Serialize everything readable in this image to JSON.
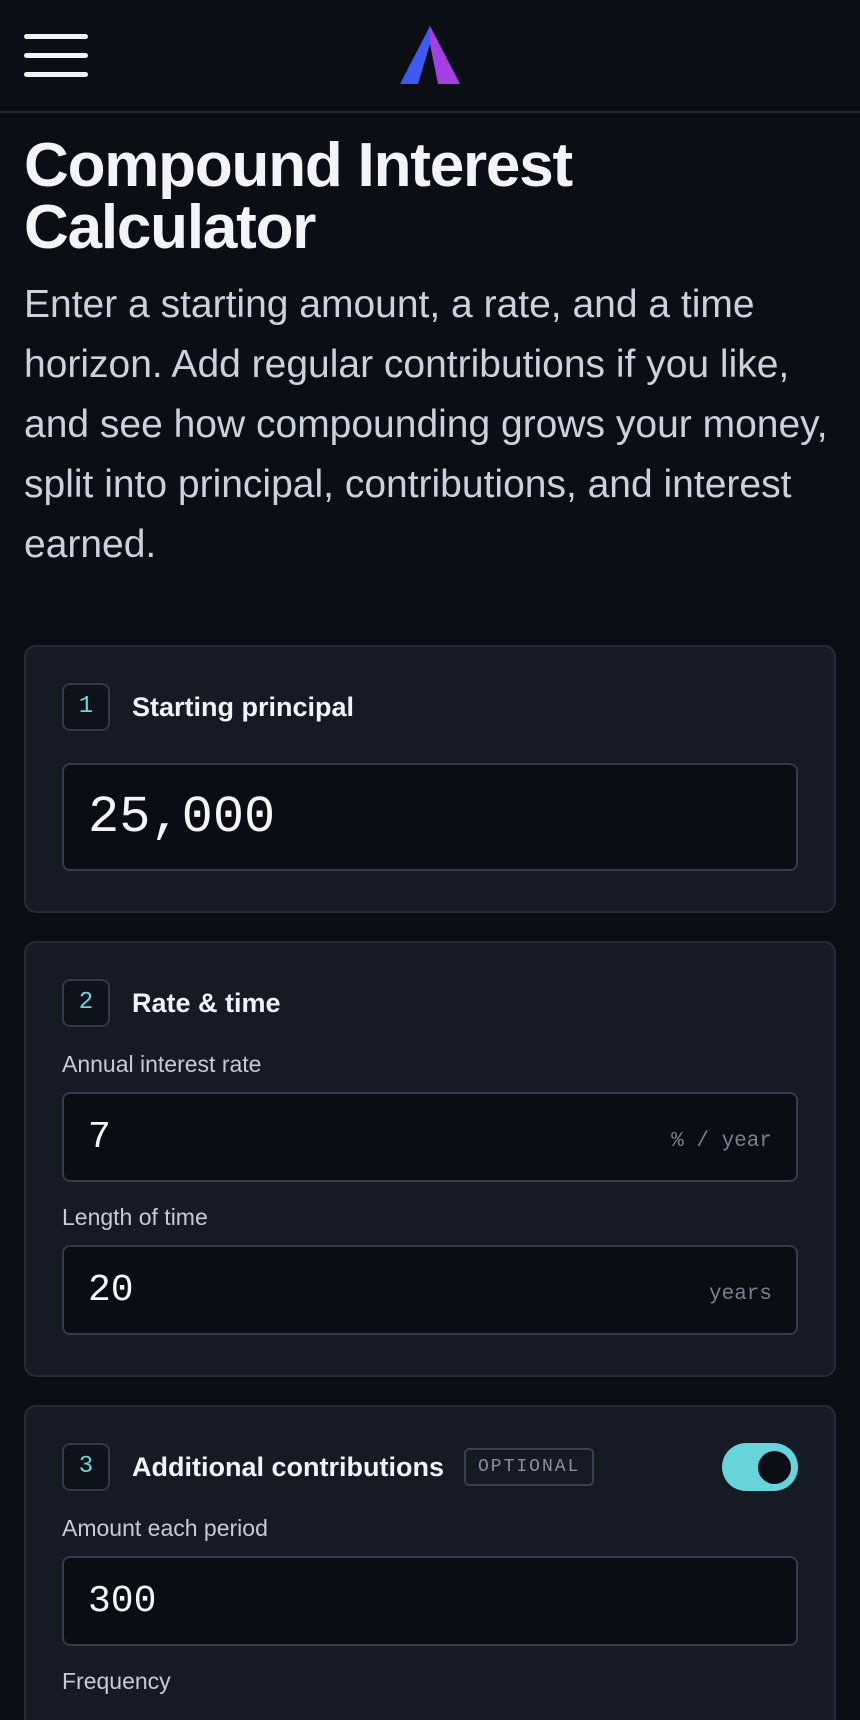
{
  "header": {
    "menu_icon": "hamburger-menu-icon",
    "logo_icon": "brand-a-logo",
    "logo_colors": [
      "#3f5af0",
      "#a43fe3"
    ]
  },
  "page": {
    "title": "Compound Interest Calculator",
    "intro": "Enter a starting amount, a rate, and a time horizon. Add regular contributions if you like, and see how compounding grows your money, split into principal, contributions, and interest earned."
  },
  "steps": {
    "principal": {
      "number": "1",
      "title": "Starting principal",
      "value": "25,000"
    },
    "rate_time": {
      "number": "2",
      "title": "Rate & time",
      "rate_label": "Annual interest rate",
      "rate_value": "7",
      "rate_suffix": "% / year",
      "time_label": "Length of time",
      "time_value": "20",
      "time_suffix": "years"
    },
    "contributions": {
      "number": "3",
      "title": "Additional contributions",
      "badge": "OPTIONAL",
      "enabled": true,
      "amount_label": "Amount each period",
      "amount_value": "300",
      "frequency_label": "Frequency"
    }
  },
  "colors": {
    "accent": "#67d4db",
    "background": "#0b0e15",
    "card": "#151a25"
  }
}
